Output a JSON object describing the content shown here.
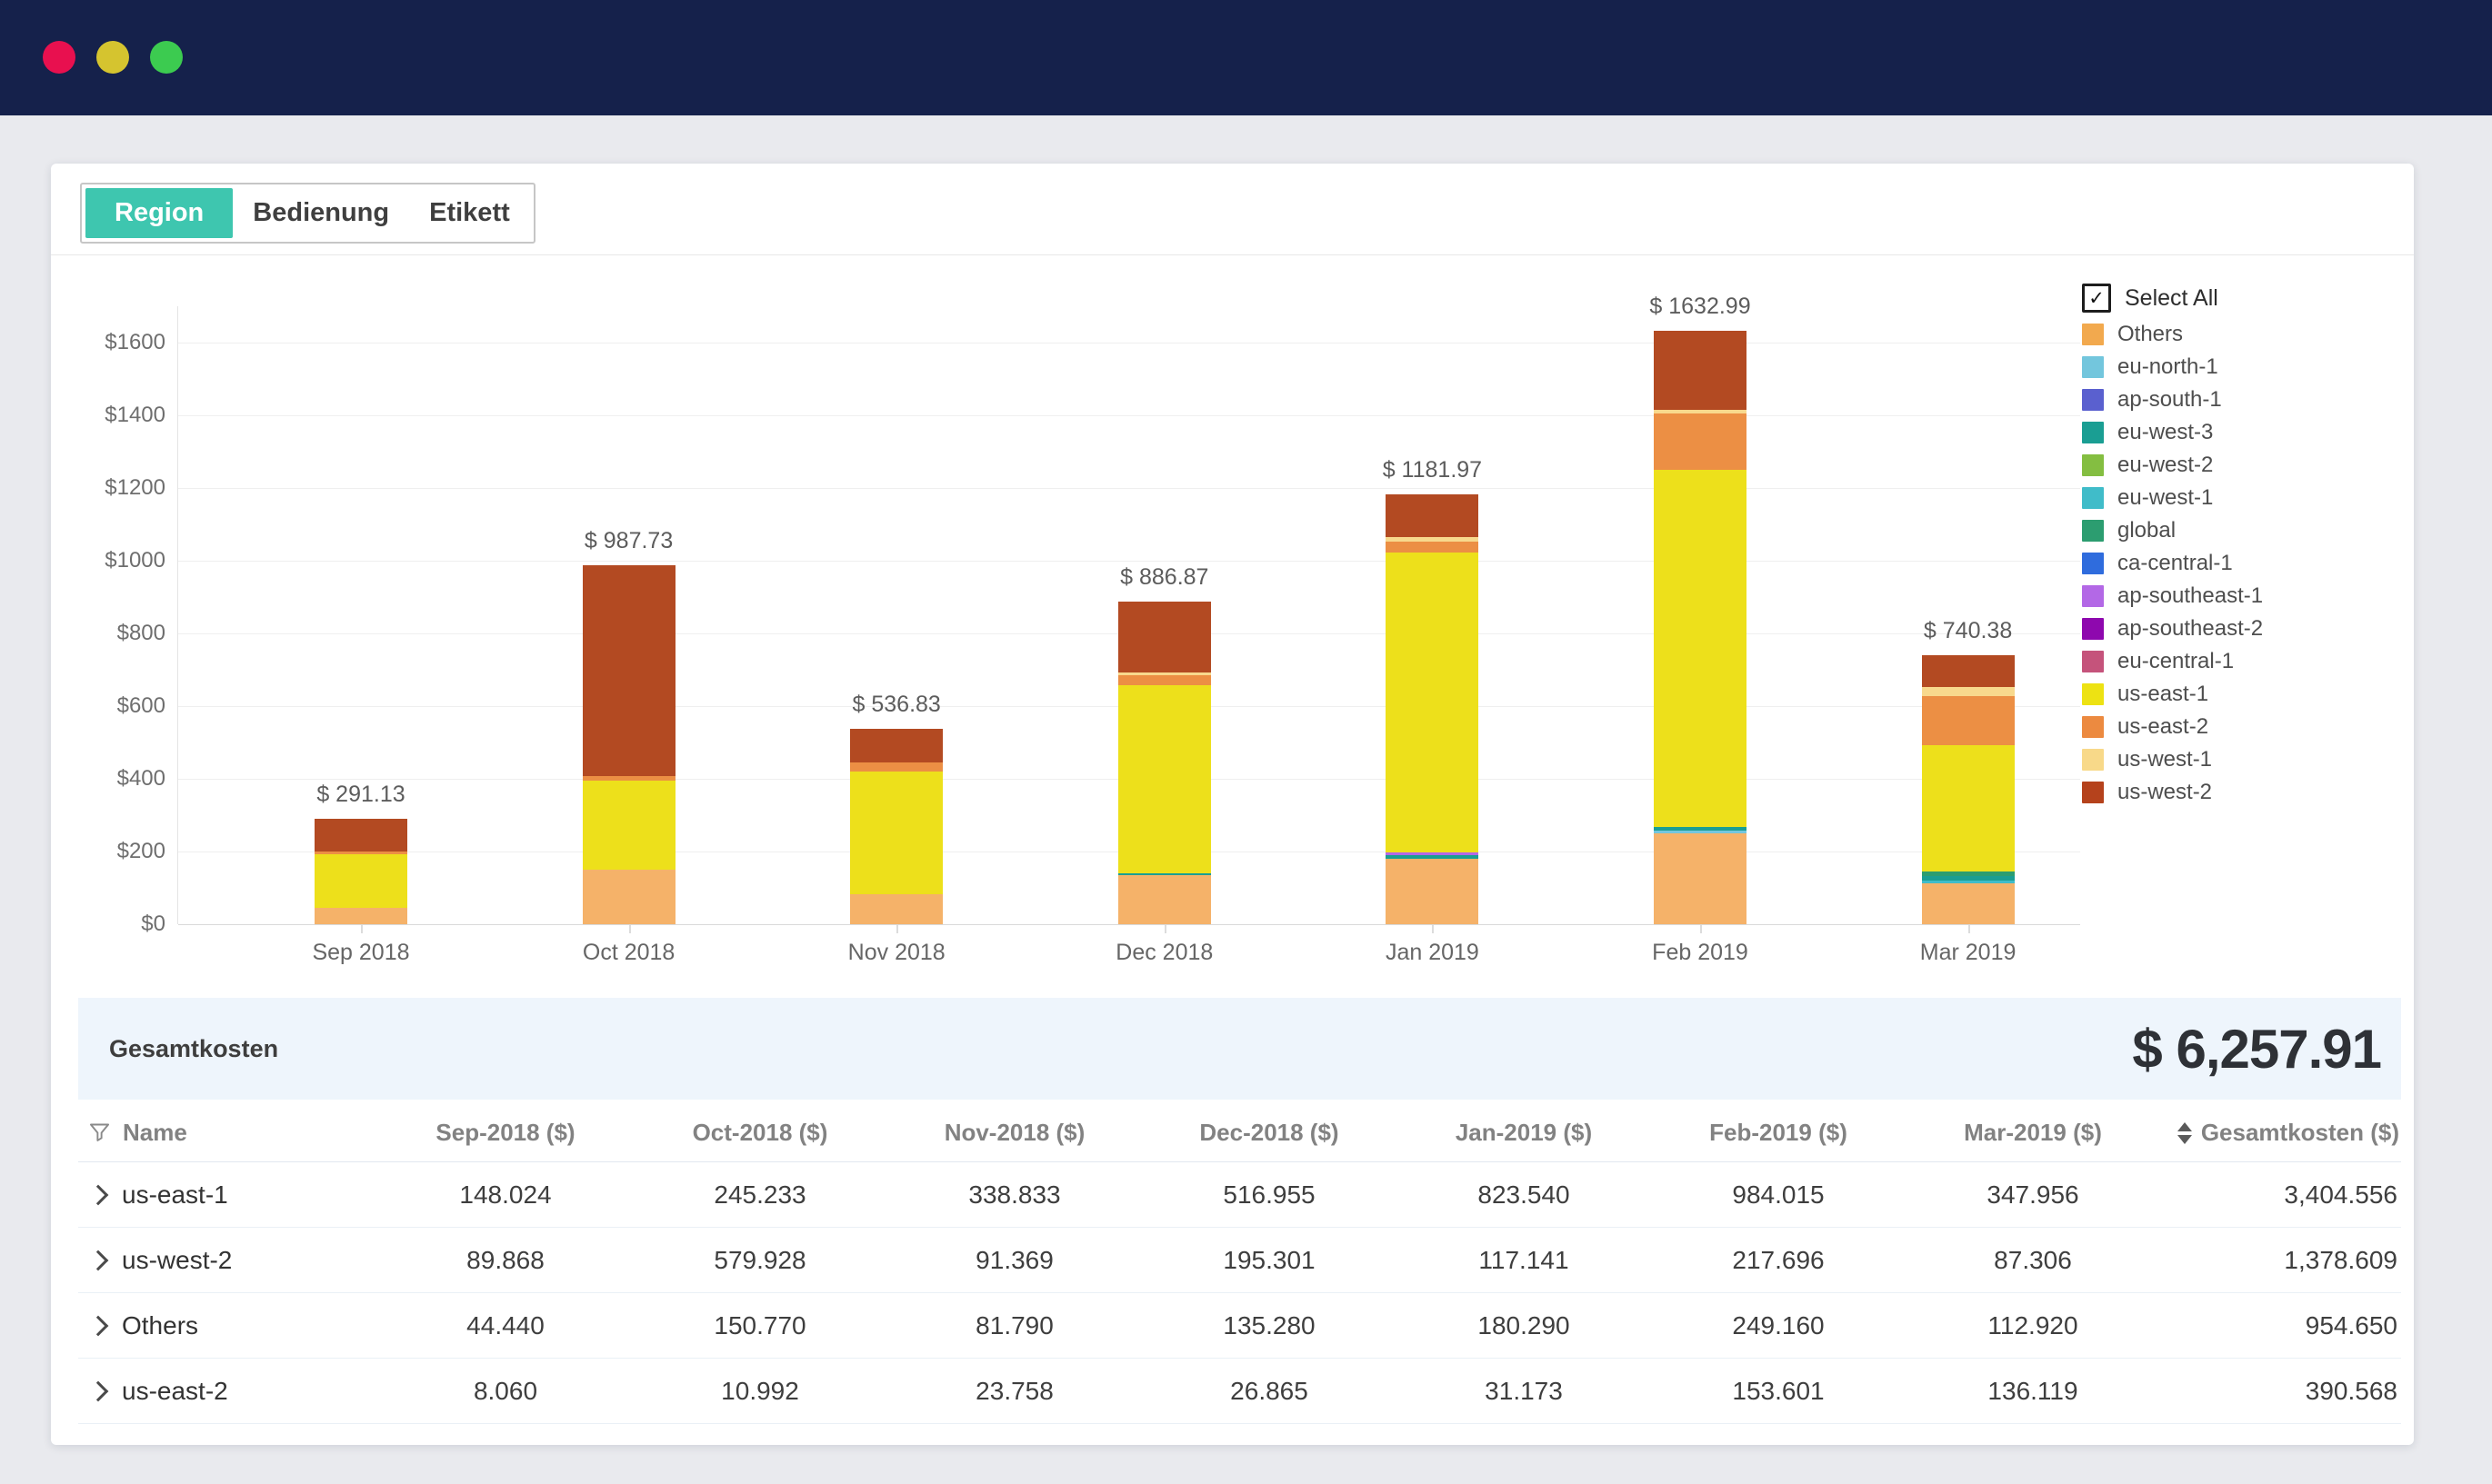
{
  "window": {
    "traffic_lights": [
      "close",
      "minimize",
      "zoom"
    ]
  },
  "tabs": [
    {
      "label": "Region",
      "active": true
    },
    {
      "label": "Bedienung",
      "active": false
    },
    {
      "label": "Etikett",
      "active": false
    }
  ],
  "chart_data": {
    "type": "bar",
    "stacked": true,
    "categories": [
      "Sep 2018",
      "Oct 2018",
      "Nov 2018",
      "Dec 2018",
      "Jan 2019",
      "Feb 2019",
      "Mar 2019"
    ],
    "totals": [
      291.13,
      987.73,
      536.83,
      886.87,
      1181.97,
      1632.99,
      740.38
    ],
    "total_labels": [
      "$ 291.13",
      "$ 987.73",
      "$ 536.83",
      "$ 886.87",
      "$ 1181.97",
      "$ 1632.99",
      "$ 740.38"
    ],
    "y_ticks": [
      "$0",
      "$200",
      "$400",
      "$600",
      "$800",
      "$1000",
      "$1200",
      "$1400",
      "$1600"
    ],
    "y_tick_step": 200,
    "ylim": [
      0,
      1700
    ],
    "grid": true,
    "legend_position": "right",
    "series": [
      {
        "name": "Others",
        "color": "#F5B269",
        "patterned": true,
        "values": [
          44.44,
          150.77,
          81.79,
          135.28,
          180.29,
          249.16,
          112.92
        ]
      },
      {
        "name": "eu-north-1",
        "color": "#73C6DD",
        "patterned": false,
        "values": [
          0,
          0,
          0,
          0,
          0,
          9,
          0
        ]
      },
      {
        "name": "eu-west-1",
        "color": "#40BCC9",
        "patterned": false,
        "values": [
          0,
          0,
          0,
          0,
          0,
          0,
          8
        ]
      },
      {
        "name": "eu-west-3",
        "color": "#1A9E93",
        "patterned": false,
        "values": [
          0,
          0,
          0,
          6,
          9,
          9,
          12
        ]
      },
      {
        "name": "global",
        "color": "#2C9D70",
        "patterned": true,
        "values": [
          0,
          0,
          0,
          0,
          0,
          0,
          11
        ]
      },
      {
        "name": "ap-southeast-1",
        "color": "#B368E6",
        "patterned": true,
        "values": [
          0,
          0,
          0,
          0,
          9,
          0,
          0
        ]
      },
      {
        "name": "us-east-1",
        "color": "#EDE01B",
        "patterned": false,
        "values": [
          148.02,
          245.23,
          338.83,
          516.96,
          823.54,
          984.02,
          347.96
        ]
      },
      {
        "name": "us-east-2",
        "color": "#EC8F44",
        "patterned": true,
        "values": [
          8.06,
          10.99,
          23.76,
          26.87,
          31.17,
          153.6,
          136.12
        ]
      },
      {
        "name": "us-west-1",
        "color": "#F8D98D",
        "patterned": true,
        "values": [
          0.8,
          0.8,
          1.1,
          6.5,
          11.8,
          10.5,
          25
        ]
      },
      {
        "name": "us-west-2",
        "color": "#B34A22",
        "patterned": false,
        "values": [
          89.87,
          579.93,
          91.37,
          195.3,
          117.14,
          217.7,
          87.31
        ]
      }
    ],
    "legend": {
      "select_all": "Select All",
      "select_all_checked": true,
      "items": [
        {
          "name": "Others",
          "color": "#F2A94E",
          "patterned": true
        },
        {
          "name": "eu-north-1",
          "color": "#73C6DD",
          "patterned": false
        },
        {
          "name": "ap-south-1",
          "color": "#5A60CF",
          "patterned": true
        },
        {
          "name": "eu-west-3",
          "color": "#1A9E93",
          "patterned": false
        },
        {
          "name": "eu-west-2",
          "color": "#84BE41",
          "patterned": false
        },
        {
          "name": "eu-west-1",
          "color": "#40BCC9",
          "patterned": false
        },
        {
          "name": "global",
          "color": "#2C9D70",
          "patterned": true
        },
        {
          "name": "ca-central-1",
          "color": "#2F6CDD",
          "patterned": false
        },
        {
          "name": "ap-southeast-1",
          "color": "#B368E6",
          "patterned": true
        },
        {
          "name": "ap-southeast-2",
          "color": "#8E08AE",
          "patterned": false
        },
        {
          "name": "eu-central-1",
          "color": "#C5537B",
          "patterned": false
        },
        {
          "name": "us-east-1",
          "color": "#EDE213",
          "patterned": false
        },
        {
          "name": "us-east-2",
          "color": "#EC8A40",
          "patterned": true
        },
        {
          "name": "us-west-1",
          "color": "#F8D989",
          "patterned": true
        },
        {
          "name": "us-west-2",
          "color": "#B5421C",
          "patterned": false
        }
      ]
    }
  },
  "summary": {
    "label": "Gesamtkosten",
    "value": "$ 6,257.91"
  },
  "table": {
    "columns": [
      "Name",
      "Sep-2018 ($)",
      "Oct-2018 ($)",
      "Nov-2018 ($)",
      "Dec-2018 ($)",
      "Jan-2019 ($)",
      "Feb-2019 ($)",
      "Mar-2019 ($)",
      "Gesamtkosten ($)"
    ],
    "rows": [
      {
        "name": "us-east-1",
        "values": [
          "148.024",
          "245.233",
          "338.833",
          "516.955",
          "823.540",
          "984.015",
          "347.956",
          "3,404.556"
        ]
      },
      {
        "name": "us-west-2",
        "values": [
          "89.868",
          "579.928",
          "91.369",
          "195.301",
          "117.141",
          "217.696",
          "87.306",
          "1,378.609"
        ]
      },
      {
        "name": "Others",
        "values": [
          "44.440",
          "150.770",
          "81.790",
          "135.280",
          "180.290",
          "249.160",
          "112.920",
          "954.650"
        ]
      },
      {
        "name": "us-east-2",
        "values": [
          "8.060",
          "10.992",
          "23.758",
          "26.865",
          "31.173",
          "153.601",
          "136.119",
          "390.568"
        ]
      }
    ]
  }
}
